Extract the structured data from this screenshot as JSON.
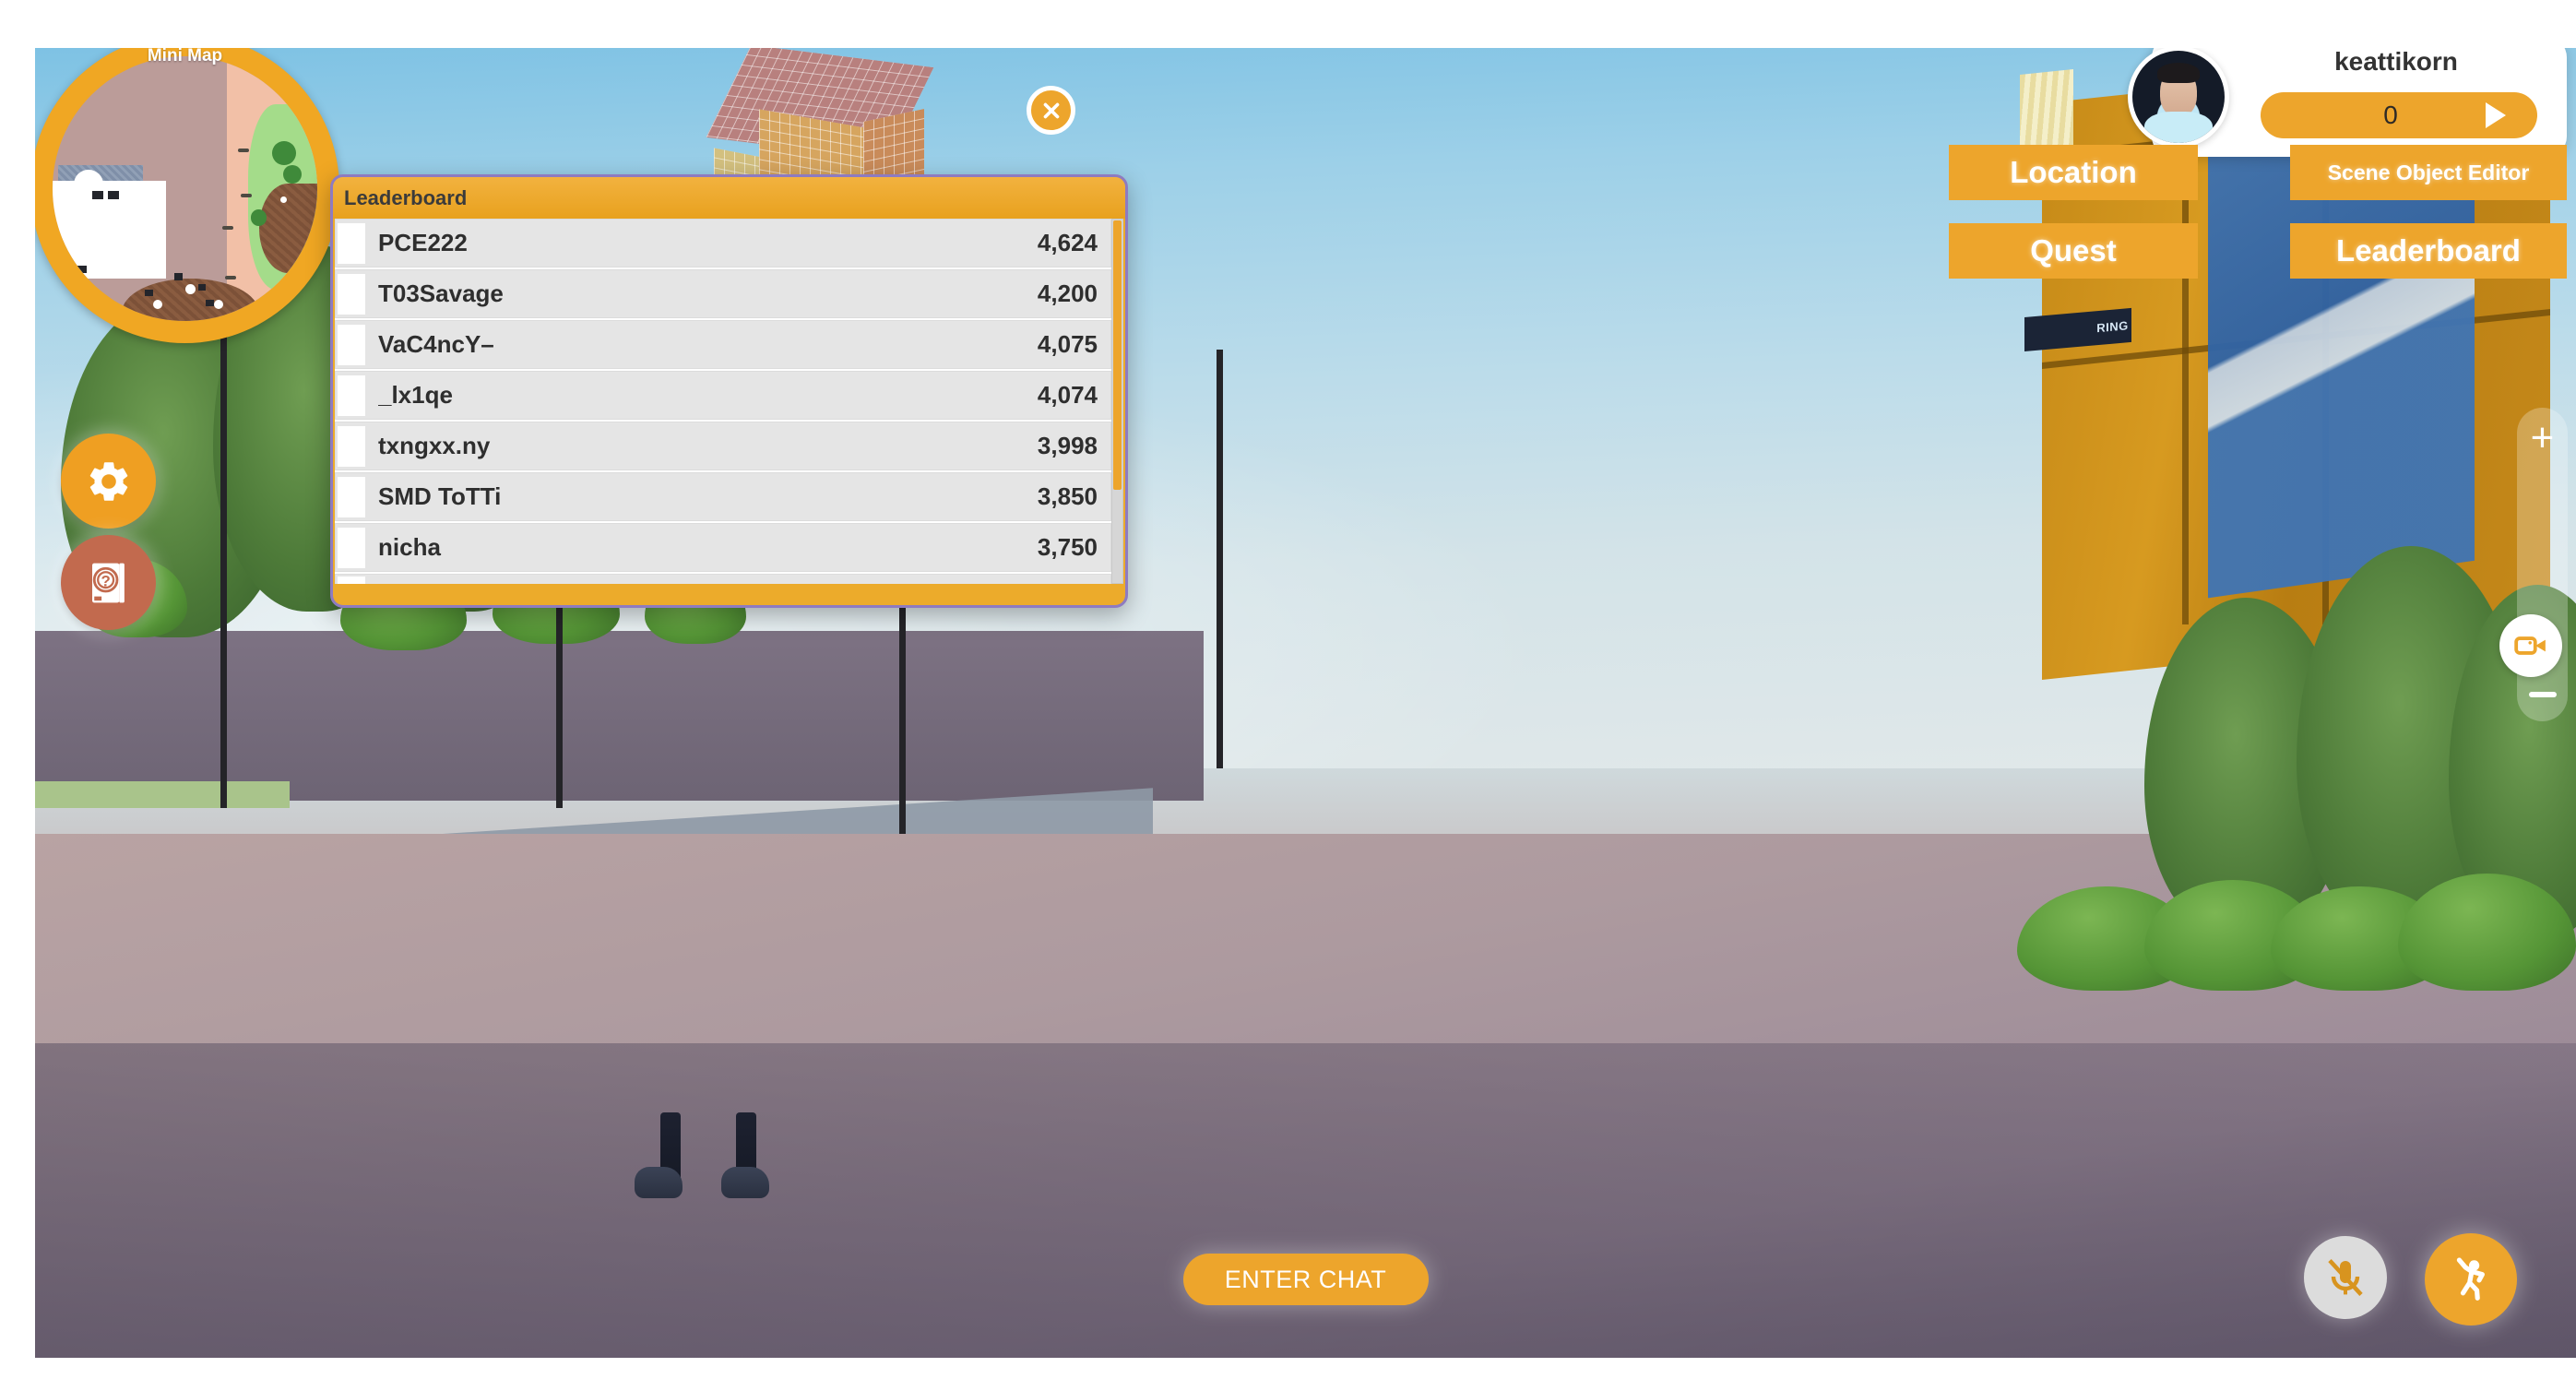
{
  "minimap": {
    "label": "Mini Map",
    "icon": "player-arrow-icon"
  },
  "left_controls": [
    {
      "name": "settings",
      "icon": "gear-icon",
      "color": "#ef9f22"
    },
    {
      "name": "help",
      "icon": "help-book-icon",
      "color": "#c26a4e"
    }
  ],
  "player_hud": {
    "name": "keattikorn",
    "score": "0",
    "arrow_icon": "play-arrow-icon",
    "avatar_icon": "avatar"
  },
  "menu_buttons": [
    {
      "label": "Location",
      "name": "location"
    },
    {
      "label": "Scene Object Editor",
      "name": "scene-object-editor"
    },
    {
      "label": "Quest",
      "name": "quest"
    },
    {
      "label": "Leaderboard",
      "name": "leaderboard"
    }
  ],
  "zoom_control": {
    "plus": "+",
    "minus": "—",
    "camera_icon": "video-camera-icon"
  },
  "bottom_bar": {
    "enter_chat": "ENTER CHAT",
    "mic_icon": "microphone-muted-icon",
    "emote_icon": "dance-emote-icon"
  },
  "leaderboard": {
    "title": "Leaderboard",
    "close_icon": "close-icon",
    "scroll_thumb_percent": 74,
    "entries": [
      {
        "name": "PCE222",
        "score": "4,624"
      },
      {
        "name": "T03Savage",
        "score": "4,200"
      },
      {
        "name": "VaC4ncY–",
        "score": "4,075"
      },
      {
        "name": "_lx1qe",
        "score": "4,074"
      },
      {
        "name": "txngxx.ny",
        "score": "3,998"
      },
      {
        "name": "SMD ToTTi",
        "score": "3,850"
      },
      {
        "name": "nicha",
        "score": "3,750"
      }
    ]
  },
  "scene": {
    "building_sign": "RING"
  },
  "colors": {
    "accent_orange": "#eda52c",
    "panel_border_purple": "#8e7bc0",
    "help_red": "#c26a4e",
    "row_grey": "#e5e5e5"
  }
}
